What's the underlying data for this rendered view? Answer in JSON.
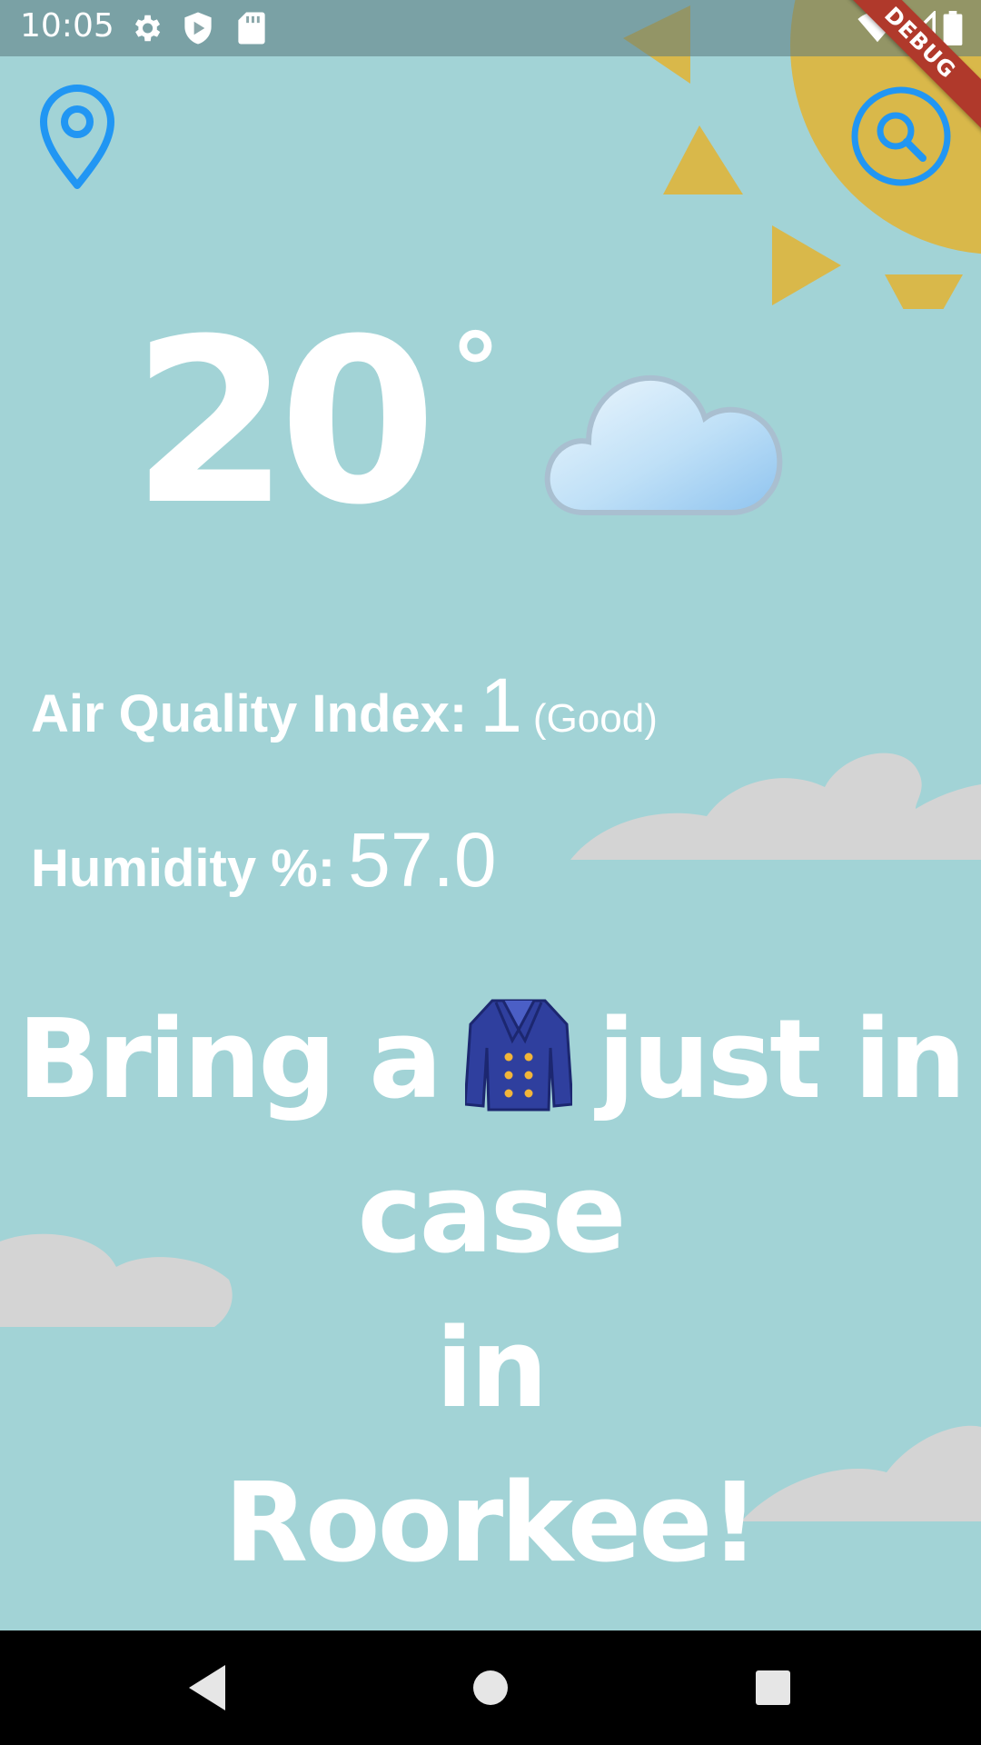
{
  "status_bar": {
    "time": "10:05",
    "left_icons": [
      "gear-icon",
      "shield-play-icon",
      "sd-card-icon"
    ],
    "right_icons": [
      "wifi-icon",
      "signal-icon",
      "battery-icon"
    ]
  },
  "debug_banner": {
    "label": "DEBUG"
  },
  "header": {
    "location_icon": "map-pin-icon",
    "search_icon": "search-icon"
  },
  "weather": {
    "temperature": "20",
    "unit": "°",
    "condition_icon": "cloud-icon"
  },
  "stats": {
    "aqi_label": "Air Quality Index:",
    "aqi_value": "1",
    "aqi_note": "(Good)",
    "humidity_label": "Humidity %:",
    "humidity_value": "57.0"
  },
  "message": {
    "line1_before": "Bring a",
    "item_icon": "coat-icon",
    "line1_after": "just in",
    "line2": "case",
    "line3": "in",
    "line4": "Roorkee!"
  },
  "nav_bar": {
    "buttons": [
      "back-icon",
      "home-icon",
      "recents-icon"
    ]
  },
  "colors": {
    "background": "#a2d3d6",
    "accent": "#2196f3",
    "sun": "#d9b84a",
    "debug": "#b0392b"
  }
}
